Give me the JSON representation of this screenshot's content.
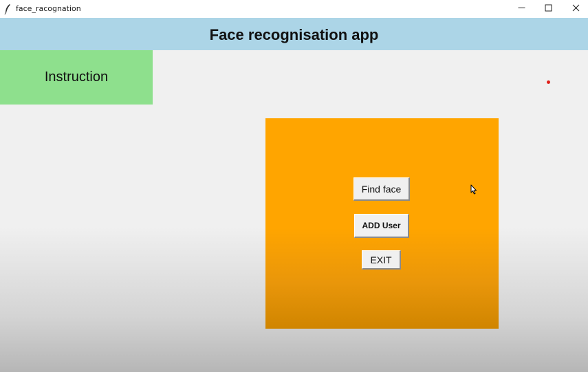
{
  "window": {
    "title": "face_racognation",
    "icon": "feather-icon",
    "controls": [
      "minimize-icon",
      "maximize-icon",
      "close-icon"
    ]
  },
  "header": {
    "title": "Face recognisation app",
    "background": "#acd5e7"
  },
  "sidebar": {
    "instruction_label": "Instruction",
    "background": "#8ee08d"
  },
  "panel": {
    "background": "#ffa500",
    "buttons": {
      "find_face": "Find face",
      "add_user": "ADD User",
      "exit": "EXIT"
    }
  },
  "indicators": {
    "dot_color": "#e0201a"
  }
}
